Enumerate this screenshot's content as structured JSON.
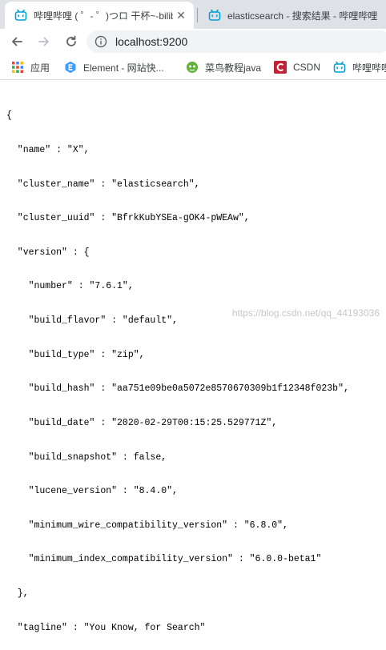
{
  "tabs": [
    {
      "title": "哔哩哔哩 ( ゜- ゜)つロ 干杯~-bilibili",
      "close": "✕",
      "active": true
    },
    {
      "title": "elasticsearch - 搜索结果 - 哔哩哔哩",
      "close": "",
      "active": false
    }
  ],
  "omnibox": {
    "url": "localhost:9200"
  },
  "bookmarks": [
    {
      "label": "应用",
      "icon": "apps-icon"
    },
    {
      "label": "Element - 网站快...",
      "icon": "element-icon"
    },
    {
      "label": "菜鸟教程java",
      "icon": "runoob-icon"
    },
    {
      "label": "CSDN",
      "icon": "csdn-icon"
    },
    {
      "label": "哔哩哔哩",
      "icon": "bilibili-icon"
    }
  ],
  "response_lines": [
    "{",
    "  \"name\" : \"X\",",
    "  \"cluster_name\" : \"elasticsearch\",",
    "  \"cluster_uuid\" : \"BfrkKubYSEa-gOK4-pWEAw\",",
    "  \"version\" : {",
    "    \"number\" : \"7.6.1\",",
    "    \"build_flavor\" : \"default\",",
    "    \"build_type\" : \"zip\",",
    "    \"build_hash\" : \"aa751e09be0a5072e8570670309b1f12348f023b\",",
    "    \"build_date\" : \"2020-02-29T00:15:25.529771Z\",",
    "    \"build_snapshot\" : false,",
    "    \"lucene_version\" : \"8.4.0\",",
    "    \"minimum_wire_compatibility_version\" : \"6.8.0\",",
    "    \"minimum_index_compatibility_version\" : \"6.0.0-beta1\"",
    "  },",
    "  \"tagline\" : \"You Know, for Search\"",
    "}"
  ],
  "watermark": "https://blog.csdn.net/qq_44193036",
  "colors": {
    "tabstrip": "#dee1e6",
    "bilibili": "#00a1d6",
    "csdn": "#c32136",
    "element": "#409eff"
  }
}
